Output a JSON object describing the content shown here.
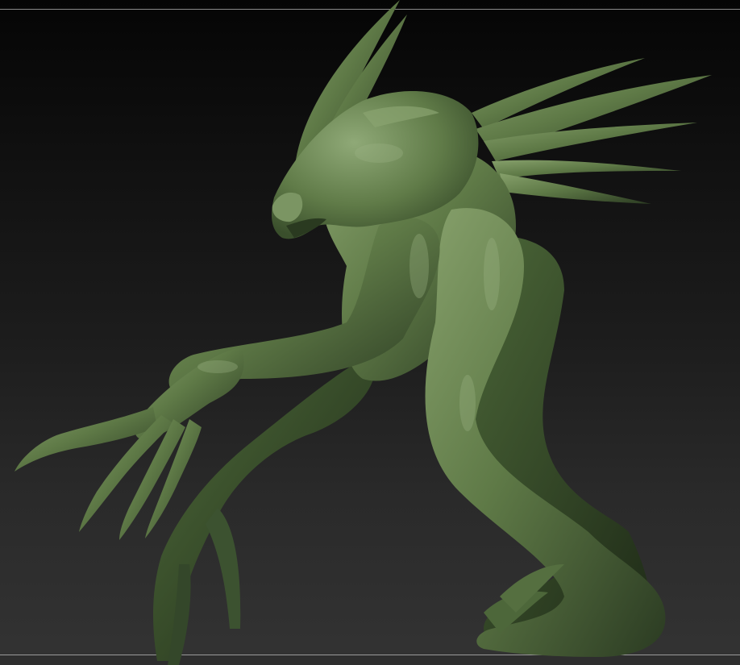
{
  "viewport": {
    "background_top": "#050505",
    "background_bottom": "#333333",
    "frame_line_color": "#8a8a8a"
  },
  "model": {
    "icon": "creature-sculpt",
    "skin_base": "#5f7a47",
    "skin_light": "#7f9a65",
    "skin_shadow": "#34472a",
    "skin_dark": "#223019"
  }
}
